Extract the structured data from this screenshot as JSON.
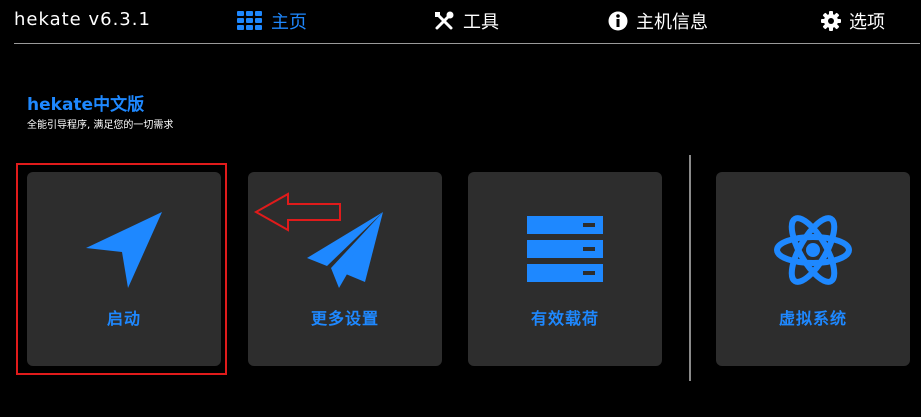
{
  "topbar": {
    "title": "hekate v6.3.1",
    "nav": [
      {
        "label": "主页",
        "icon": "grid-icon",
        "active": true
      },
      {
        "label": "工具",
        "icon": "tools-icon",
        "active": false
      },
      {
        "label": "主机信息",
        "icon": "info-icon",
        "active": false
      },
      {
        "label": "选项",
        "icon": "gear-icon",
        "active": false
      }
    ]
  },
  "main": {
    "heading": "hekate中文版",
    "subheading": "全能引导程序, 满足您的一切需求",
    "tiles": [
      {
        "label": "启动",
        "icon": "send-icon"
      },
      {
        "label": "更多设置",
        "icon": "paper-plane-icon"
      },
      {
        "label": "有效载荷",
        "icon": "server-icon"
      },
      {
        "label": "虚拟系统",
        "icon": "atom-icon"
      }
    ]
  },
  "colors": {
    "accent": "#1e88ff",
    "background": "#000000",
    "tile": "#2d2d2d",
    "annotation": "#e01b1b"
  }
}
